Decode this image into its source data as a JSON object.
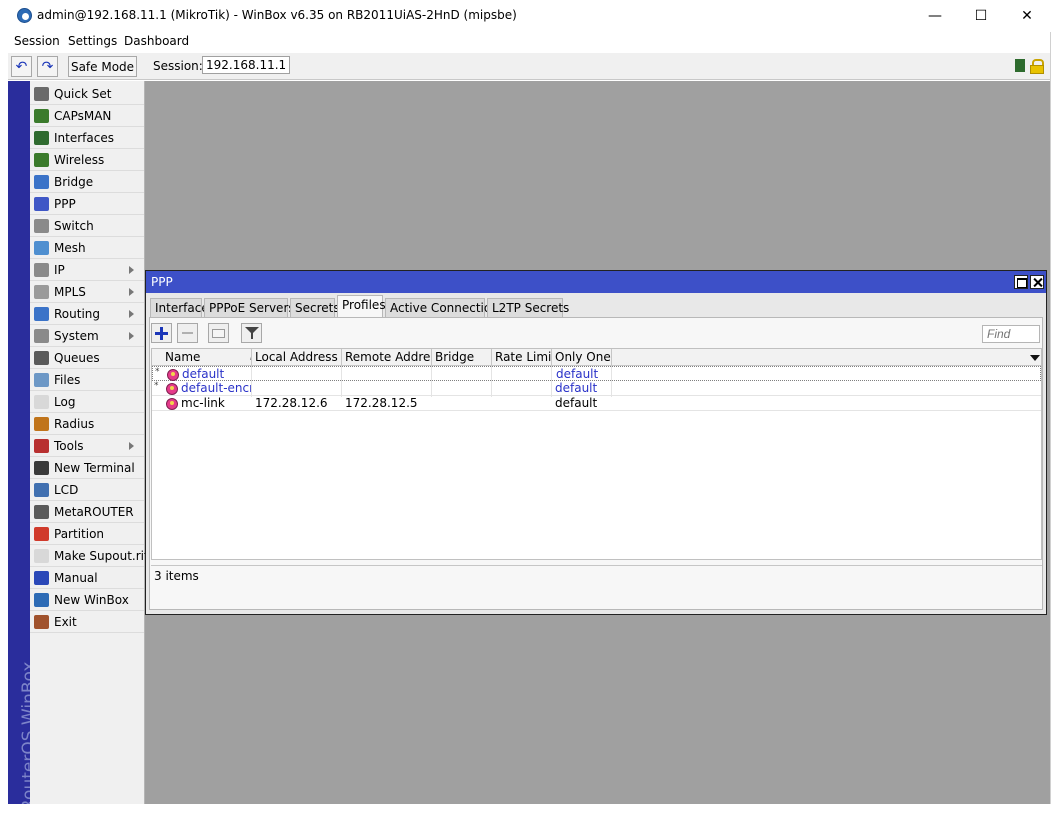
{
  "window": {
    "title": "admin@192.168.11.1 (MikroTik) - WinBox v6.35 on RB2011UiAS-2HnD (mipsbe)",
    "controls": {
      "minimize": "—",
      "maximize": "☐",
      "close": "✕"
    }
  },
  "menubar": {
    "items": [
      "Session",
      "Settings",
      "Dashboard"
    ]
  },
  "toolbar": {
    "undo_icon": "↶",
    "redo_icon": "↷",
    "safe_mode_label": "Safe Mode",
    "session_label": "Session:",
    "session_value": "192.168.11.1"
  },
  "brand": {
    "vertical_text": "RouterOS WinBox",
    "strip_color": "#2a2d9c"
  },
  "sidebar": {
    "items": [
      {
        "label": "Quick Set",
        "icon": "quick-set-icon",
        "submenu": false,
        "color": "#6a6a6a"
      },
      {
        "label": "CAPsMAN",
        "icon": "capsman-icon",
        "submenu": false,
        "color": "#3b7b2c"
      },
      {
        "label": "Interfaces",
        "icon": "interfaces-icon",
        "submenu": false,
        "color": "#2f6b2f"
      },
      {
        "label": "Wireless",
        "icon": "wireless-icon",
        "submenu": false,
        "color": "#3b7b2c"
      },
      {
        "label": "Bridge",
        "icon": "bridge-icon",
        "submenu": false,
        "color": "#3b73c8"
      },
      {
        "label": "PPP",
        "icon": "ppp-icon",
        "submenu": false,
        "color": "#3f57c6"
      },
      {
        "label": "Switch",
        "icon": "switch-icon",
        "submenu": false,
        "color": "#8a8a8a"
      },
      {
        "label": "Mesh",
        "icon": "mesh-icon",
        "submenu": false,
        "color": "#4f8fd0"
      },
      {
        "label": "IP",
        "icon": "ip-icon",
        "submenu": true,
        "color": "#8a8a8a"
      },
      {
        "label": "MPLS",
        "icon": "mpls-icon",
        "submenu": true,
        "color": "#9a9a9a"
      },
      {
        "label": "Routing",
        "icon": "routing-icon",
        "submenu": true,
        "color": "#3b73c8"
      },
      {
        "label": "System",
        "icon": "system-icon",
        "submenu": true,
        "color": "#8a8a8a"
      },
      {
        "label": "Queues",
        "icon": "queues-icon",
        "submenu": false,
        "color": "#5a5a5a"
      },
      {
        "label": "Files",
        "icon": "files-icon",
        "submenu": false,
        "color": "#6d98c6"
      },
      {
        "label": "Log",
        "icon": "log-icon",
        "submenu": false,
        "color": "#d8d8d8"
      },
      {
        "label": "Radius",
        "icon": "radius-icon",
        "submenu": false,
        "color": "#c0741b"
      },
      {
        "label": "Tools",
        "icon": "tools-icon",
        "submenu": true,
        "color": "#b83030"
      },
      {
        "label": "New Terminal",
        "icon": "terminal-icon",
        "submenu": false,
        "color": "#3a3a3a"
      },
      {
        "label": "LCD",
        "icon": "lcd-icon",
        "submenu": false,
        "color": "#4170b0"
      },
      {
        "label": "MetaROUTER",
        "icon": "metarouter-icon",
        "submenu": false,
        "color": "#5a5a5a"
      },
      {
        "label": "Partition",
        "icon": "partition-icon",
        "submenu": false,
        "color": "#d03a2b"
      },
      {
        "label": "Make Supout.rif",
        "icon": "supout-icon",
        "submenu": false,
        "color": "#d8d8d8"
      },
      {
        "label": "Manual",
        "icon": "manual-icon",
        "submenu": false,
        "color": "#2a48b8"
      },
      {
        "label": "New WinBox",
        "icon": "winbox-icon",
        "submenu": false,
        "color": "#2d6bb5"
      },
      {
        "label": "Exit",
        "icon": "exit-icon",
        "submenu": false,
        "color": "#a0522d"
      }
    ]
  },
  "ppp_window": {
    "title": "PPP",
    "tabs": [
      "Interface",
      "PPPoE Servers",
      "Secrets",
      "Profiles",
      "Active Connections",
      "L2TP Secrets"
    ],
    "active_tab": "Profiles",
    "find_placeholder": "Find",
    "columns": [
      "Name",
      "Local Address",
      "Remote Address",
      "Bridge",
      "Rate Limit...",
      "Only One"
    ],
    "rows": [
      {
        "marker": "*",
        "name": "default",
        "local_address": "",
        "remote_address": "",
        "bridge": "",
        "rate_limit": "",
        "only_one": "default",
        "is_default": true
      },
      {
        "marker": "*",
        "name": "default-encr...",
        "local_address": "",
        "remote_address": "",
        "bridge": "",
        "rate_limit": "",
        "only_one": "default",
        "is_default": true
      },
      {
        "marker": "",
        "name": "mc-link",
        "local_address": "172.28.12.6",
        "remote_address": "172.28.12.5",
        "bridge": "",
        "rate_limit": "",
        "only_one": "default",
        "is_default": false
      }
    ],
    "status": "3 items"
  }
}
